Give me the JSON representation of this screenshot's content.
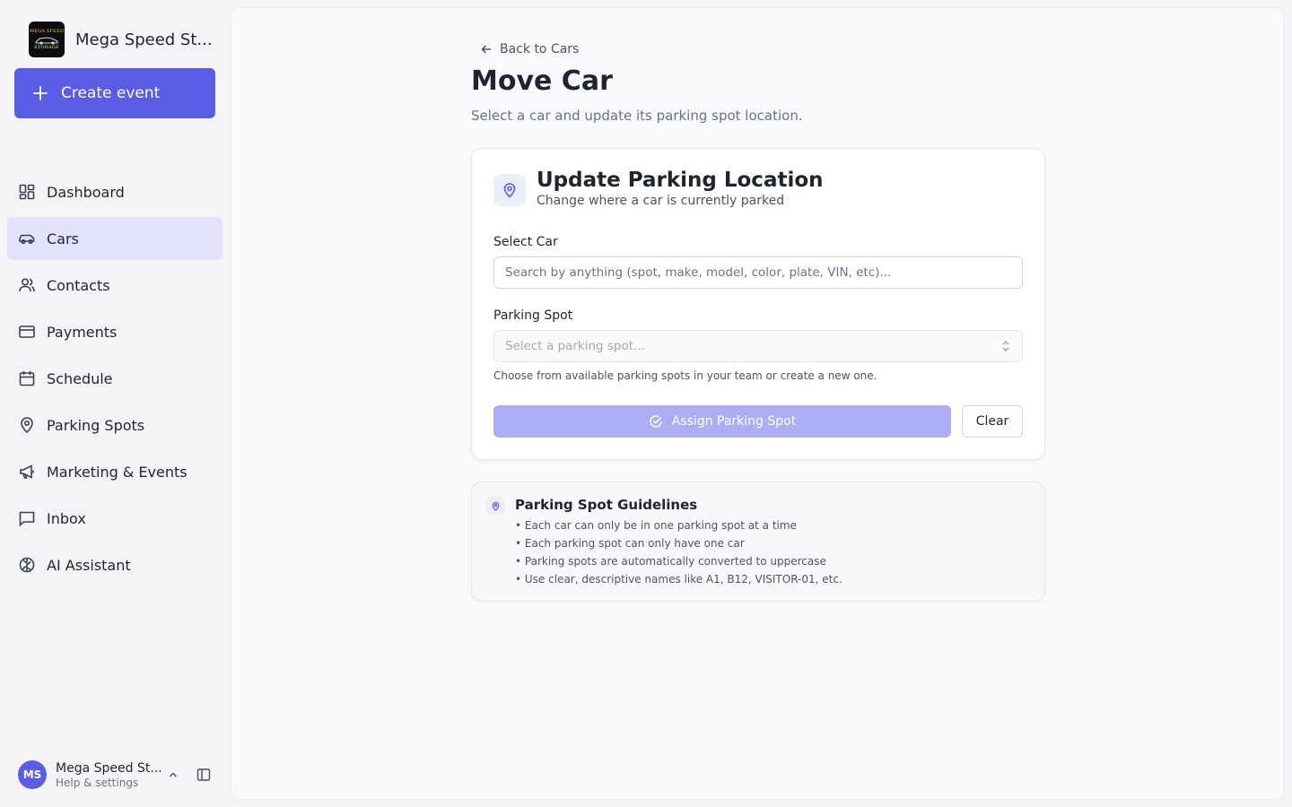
{
  "brand": {
    "logo_text_top": "MEGA SPEED",
    "logo_text_bottom": "STORAGE",
    "name": "Mega Speed St..."
  },
  "sidebar": {
    "create_label": "Create event",
    "items": [
      {
        "label": "Dashboard",
        "icon": "dashboard-icon",
        "active": false
      },
      {
        "label": "Cars",
        "icon": "car-icon",
        "active": true
      },
      {
        "label": "Contacts",
        "icon": "users-icon",
        "active": false
      },
      {
        "label": "Payments",
        "icon": "credit-card-icon",
        "active": false
      },
      {
        "label": "Schedule",
        "icon": "calendar-icon",
        "active": false
      },
      {
        "label": "Parking Spots",
        "icon": "map-pin-icon",
        "active": false
      },
      {
        "label": "Marketing & Events",
        "icon": "megaphone-icon",
        "active": false
      },
      {
        "label": "Inbox",
        "icon": "message-square-icon",
        "active": false
      },
      {
        "label": "AI Assistant",
        "icon": "brain-icon",
        "active": false
      }
    ]
  },
  "user": {
    "initials": "MS",
    "name": "Mega Speed St...",
    "subtitle": "Help & settings"
  },
  "page": {
    "back_label": "Back to Cars",
    "title": "Move Car",
    "subtitle": "Select a car and update its parking spot location."
  },
  "card": {
    "title": "Update Parking Location",
    "subtitle": "Change where a car is currently parked",
    "select_car_label": "Select Car",
    "select_car_placeholder": "Search by anything (spot, make, model, color, plate, VIN, etc)...",
    "select_car_value": "",
    "parking_spot_label": "Parking Spot",
    "parking_spot_placeholder": "Select a parking spot...",
    "helper": "Choose from available parking spots in your team or create a new one.",
    "assign_label": "Assign Parking Spot",
    "clear_label": "Clear"
  },
  "guidelines": {
    "title": "Parking Spot Guidelines",
    "items": [
      "• Each car can only be in one parking spot at a time",
      "• Each parking spot can only have one car",
      "• Parking spots are automatically converted to uppercase",
      "• Use clear, descriptive names like A1, B12, VISITOR-01, etc."
    ]
  },
  "colors": {
    "accent": "#5b5ce6",
    "accent_disabled": "#acadf3",
    "active_nav_bg": "#e2e3fb"
  }
}
